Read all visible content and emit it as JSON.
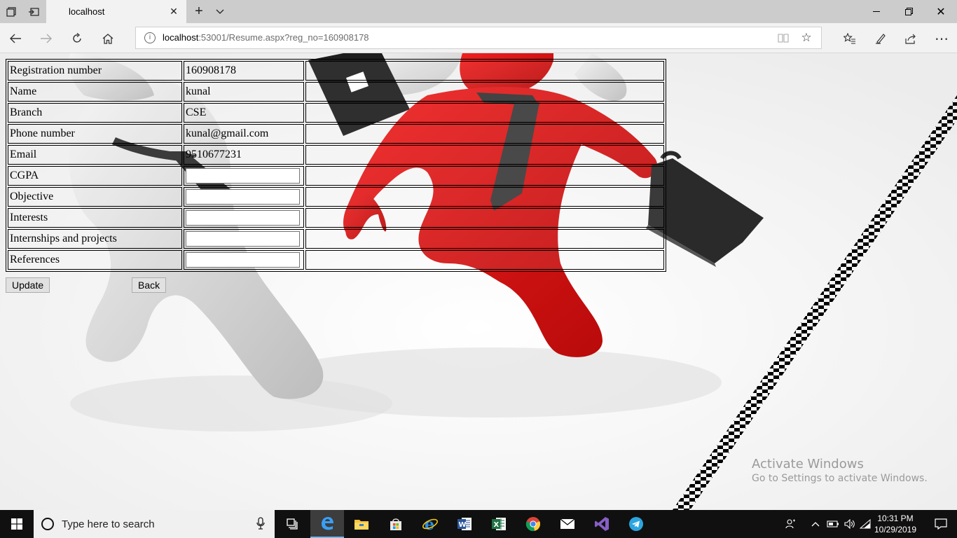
{
  "browser": {
    "tab_title": "localhost",
    "address": {
      "host": "localhost",
      "rest": ":53001/Resume.aspx?reg_no=160908178"
    }
  },
  "resume": {
    "rows": [
      {
        "label": "Registration number",
        "value": "160908178"
      },
      {
        "label": "Name",
        "value": "kunal"
      },
      {
        "label": "Branch",
        "value": "CSE"
      },
      {
        "label": "Phone number",
        "value": "kunal@gmail.com"
      },
      {
        "label": "Email",
        "value": "9510677231"
      },
      {
        "label": "CGPA",
        "input_value": ""
      },
      {
        "label": "Objective",
        "input_value": ""
      },
      {
        "label": "Interests",
        "input_value": ""
      },
      {
        "label": "Internships and projects",
        "input_value": ""
      },
      {
        "label": "References",
        "input_value": ""
      }
    ],
    "buttons": {
      "update": "Update",
      "back": "Back"
    }
  },
  "watermark": {
    "line1": "Activate Windows",
    "line2": "Go to Settings to activate Windows."
  },
  "taskbar": {
    "search_placeholder": "Type here to search",
    "clock_time": "10:31 PM",
    "clock_date": "10/29/2019",
    "apps": [
      "task-view",
      "edge",
      "file-explorer",
      "store",
      "internet-explorer",
      "word",
      "excel",
      "chrome",
      "mail",
      "visual-studio",
      "telegram"
    ]
  },
  "colors": {
    "red_figure": "#e01010",
    "taskbar": "#101010",
    "chrome_bg": "#cccccc"
  }
}
